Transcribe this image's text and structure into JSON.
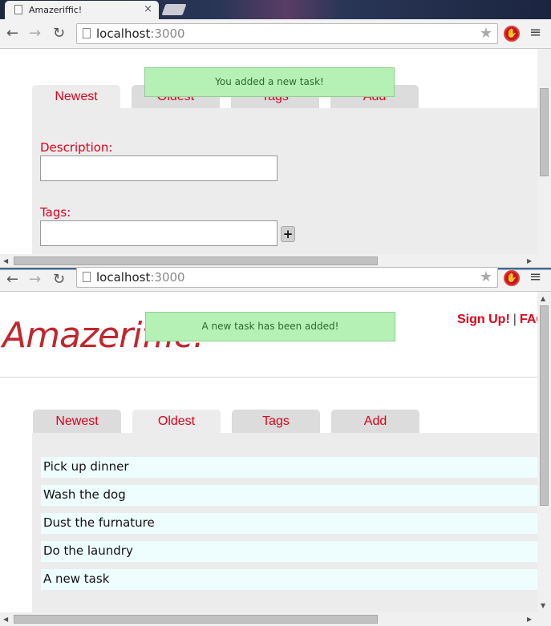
{
  "browser": {
    "tab_title": "Amazeriffic!",
    "tab_close": "×",
    "url_host": "localhost",
    "url_port": ":3000",
    "back_glyph": "←",
    "forward_glyph": "→",
    "reload_glyph": "↻",
    "star_glyph": "★",
    "menu_glyph": "≡"
  },
  "top_window": {
    "toast": "You added a new task!",
    "tabs": [
      "Newest",
      "Oldest",
      "Tags",
      "Add"
    ],
    "description_label": "Description:",
    "tags_label": "Tags:",
    "plus_label": "+"
  },
  "bottom_window": {
    "logo": "Amazeriffic!",
    "signup_link": "Sign Up!",
    "separator": "|",
    "faq_link": "FAQ",
    "toast": "A new task has been added!",
    "tabs": [
      "Newest",
      "Oldest",
      "Tags",
      "Add"
    ],
    "tasks": [
      "Pick up dinner",
      "Wash the dog",
      "Dust the furnature",
      "Do the laundry",
      "A new task"
    ]
  },
  "colors": {
    "accent_red": "#e0001a",
    "toast_green": "#b5f0b5",
    "task_bg": "#eefefe",
    "logo_red": "#c1272d"
  }
}
